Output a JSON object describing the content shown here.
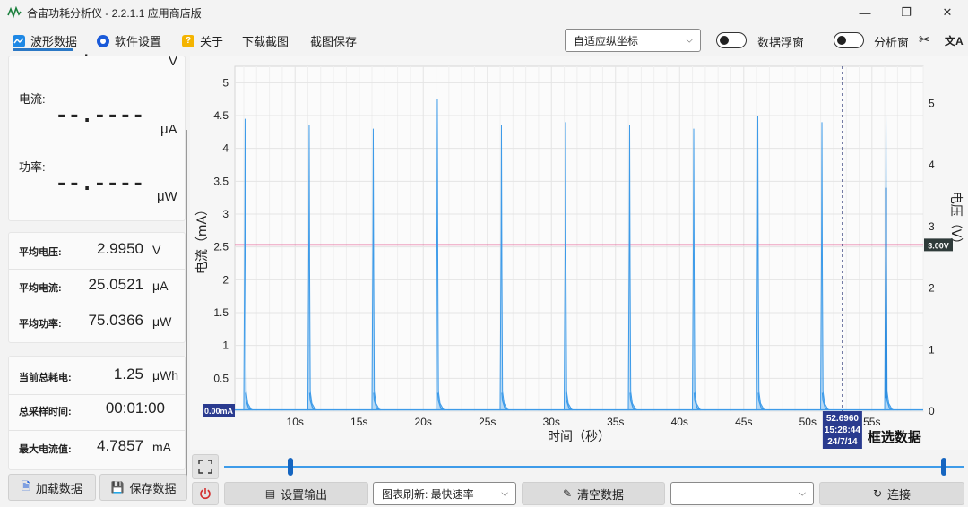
{
  "window": {
    "title": "合宙功耗分析仪 - 2.2.1.1 应用商店版",
    "min": "—",
    "max": "❐",
    "close": "✕"
  },
  "toolbar": {
    "tab_waveform": "波形数据",
    "tab_settings": "软件设置",
    "tab_about": "关于",
    "download_screenshot": "下载截图",
    "save_screenshot": "截图保存",
    "axis_mode": "自适应纵坐标",
    "toggle_float_label": "数据浮窗",
    "toggle_analysis_label": "分析窗",
    "scissors_icon": "✂",
    "translate_icon": "文A"
  },
  "readout": {
    "voltage_unit": "V",
    "current_label": "电流:",
    "current_value": "--.----",
    "current_unit": "μA",
    "power_label": "功率:",
    "power_value": "--.----",
    "power_unit": "μW"
  },
  "averages": [
    {
      "label": "平均电压:",
      "value": "2.9950",
      "unit": "V"
    },
    {
      "label": "平均电流:",
      "value": "25.0521",
      "unit": "μA"
    },
    {
      "label": "平均功率:",
      "value": "75.0366",
      "unit": "μW"
    }
  ],
  "totals": [
    {
      "label": "当前总耗电:",
      "value": "1.25",
      "unit": "μWh"
    },
    {
      "label": "总采样时间:",
      "value": "00:01:00",
      "unit": ""
    },
    {
      "label": "最大电流值:",
      "value": "4.7857",
      "unit": "mA"
    }
  ],
  "buttons": {
    "load_data": "加载数据",
    "save_data": "保存数据",
    "set_output": "设置输出",
    "refresh_select": "图表刷新: 最快速率",
    "clear_data": "清空数据",
    "port_select": "",
    "connect": "连接"
  },
  "chart_data": {
    "type": "line",
    "xlabel": "时间（秒）",
    "ylabel": "电流（mA）",
    "y2label": "电压（V）",
    "x_ticks": [
      "10s",
      "15s",
      "20s",
      "25s",
      "30s",
      "35s",
      "40s",
      "45s",
      "50s",
      "55s"
    ],
    "x_tick_values": [
      10,
      15,
      20,
      25,
      30,
      35,
      40,
      45,
      50,
      55
    ],
    "xlim": [
      5.3,
      59.0
    ],
    "ylim": [
      0,
      5.25
    ],
    "y_ticks": [
      0,
      0.5,
      1,
      1.5,
      2,
      2.5,
      3,
      3.5,
      4,
      4.5,
      5
    ],
    "y2lim": [
      0,
      5.6
    ],
    "y2_ticks": [
      0,
      1,
      2,
      3,
      4,
      5
    ],
    "grid": true,
    "voltage_level": 2.7,
    "voltage_badge": "3.00V",
    "current_badge": "0.00mA",
    "cursor_x": 52.7,
    "cursor_time": "52.6960",
    "cursor_clock": "15:28:44",
    "cursor_date": "24/7/14",
    "select_label": "框选数据",
    "spikes": [
      {
        "t": 6.1,
        "peak": 4.45
      },
      {
        "t": 11.1,
        "peak": 4.35
      },
      {
        "t": 16.1,
        "peak": 4.3
      },
      {
        "t": 21.1,
        "peak": 4.75
      },
      {
        "t": 26.1,
        "peak": 4.35
      },
      {
        "t": 31.1,
        "peak": 4.4
      },
      {
        "t": 36.1,
        "peak": 4.35
      },
      {
        "t": 41.1,
        "peak": 4.3
      },
      {
        "t": 46.1,
        "peak": 4.5
      },
      {
        "t": 51.1,
        "peak": 4.4
      },
      {
        "t": 56.1,
        "peak": 4.5
      }
    ],
    "colors": {
      "current": "#3d9be9",
      "voltage": "#e04a86",
      "badge": "#2a3b8f",
      "badge_v": "#2f3b3a"
    }
  }
}
